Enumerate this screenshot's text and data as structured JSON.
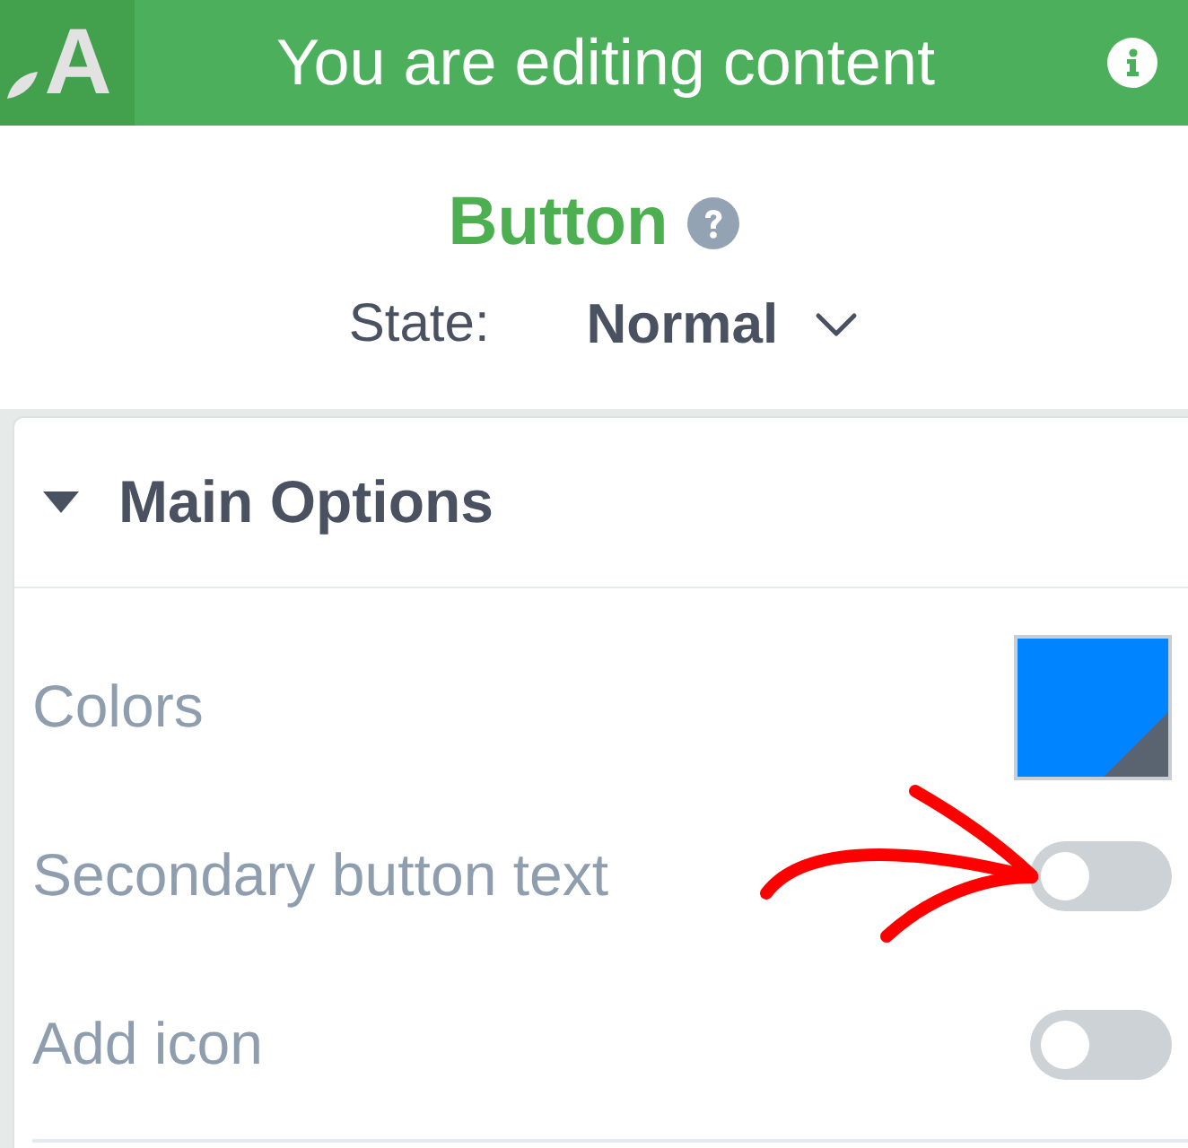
{
  "header": {
    "logo": "A",
    "title": "You are editing content"
  },
  "widget": {
    "title": "Button",
    "state_label": "State:",
    "state_value": "Normal"
  },
  "section": {
    "title": "Main Options",
    "expanded": true,
    "rows": [
      {
        "kind": "color",
        "label": "Colors",
        "color": "#0084ff"
      },
      {
        "kind": "toggle",
        "label": "Secondary button text",
        "on": false
      },
      {
        "kind": "toggle",
        "label": "Add icon",
        "on": false
      }
    ]
  }
}
